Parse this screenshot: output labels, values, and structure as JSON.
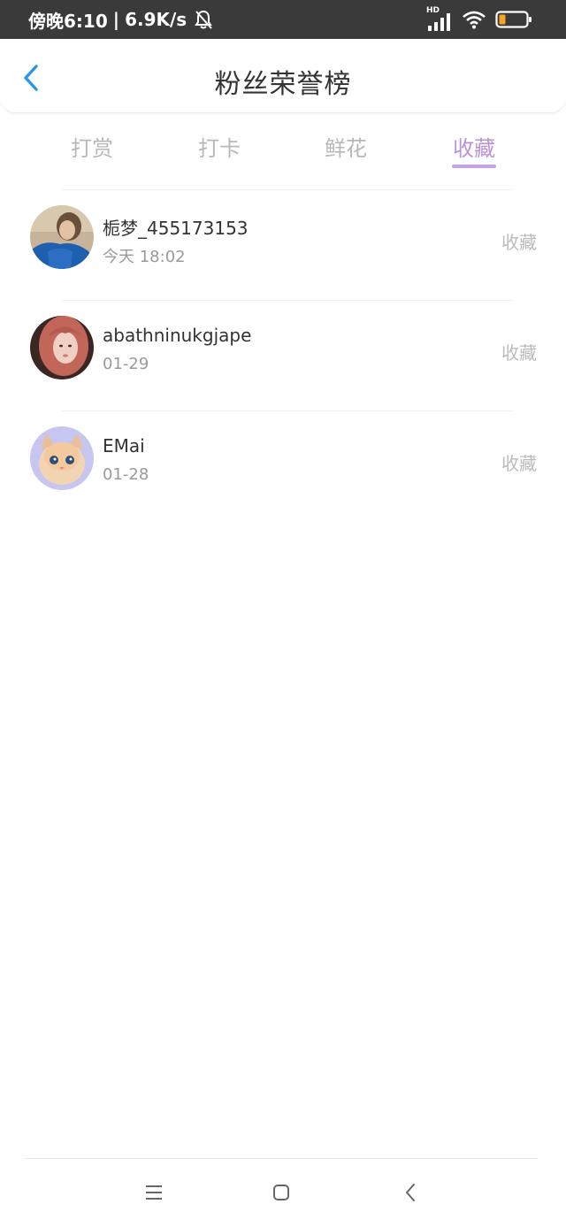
{
  "status_bar": {
    "time_text": "傍晚6:10",
    "separator": "|",
    "network_speed": "6.9K/s",
    "icons": [
      "bell-off-icon",
      "hd-signal-icon",
      "wifi-icon",
      "battery-icon"
    ],
    "signal_badge": "HD"
  },
  "header": {
    "title": "粉丝荣誉榜",
    "back_icon": "chevron-left-icon",
    "accent": "#2d95e8"
  },
  "tabs": [
    {
      "label": "打赏",
      "active": false
    },
    {
      "label": "打卡",
      "active": false
    },
    {
      "label": "鲜花",
      "active": false
    },
    {
      "label": "收藏",
      "active": true
    }
  ],
  "tab_active_color": "#b993d6",
  "fans": [
    {
      "name": "栀梦_455173153",
      "time": "今天 18:02",
      "action": "收藏",
      "avatar": "avatar-girl-blue"
    },
    {
      "name": "abathninukgjape",
      "time": "01-29",
      "action": "收藏",
      "avatar": "avatar-girl-pink-hair"
    },
    {
      "name": "EMai",
      "time": "01-28",
      "action": "收藏",
      "avatar": "avatar-kitten"
    }
  ],
  "nav_bar": {
    "icons": [
      "menu-icon",
      "home-square-icon",
      "back-triangle-icon"
    ]
  }
}
